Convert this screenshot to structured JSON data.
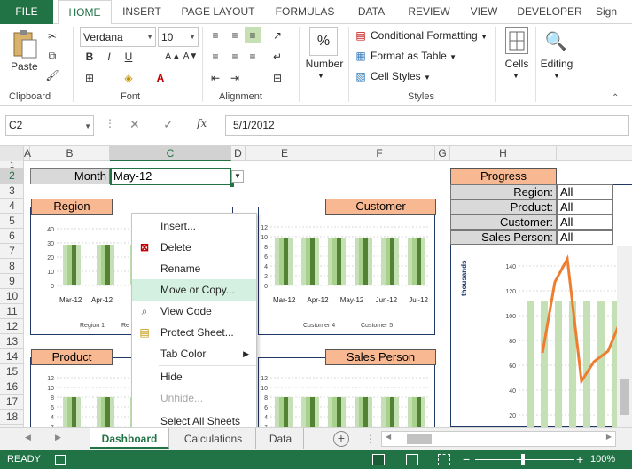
{
  "ribbon": {
    "tabs": [
      "FILE",
      "HOME",
      "INSERT",
      "PAGE LAYOUT",
      "FORMULAS",
      "DATA",
      "REVIEW",
      "VIEW",
      "DEVELOPER",
      "Sign"
    ],
    "font_name": "Verdana",
    "font_size": "10",
    "paste_label": "Paste",
    "groups": {
      "clipboard": "Clipboard",
      "font": "Font",
      "alignment": "Alignment",
      "number": "Number",
      "styles": "Styles",
      "cells": "Cells",
      "editing": "Editing"
    },
    "number_label": "Number",
    "percent_symbol": "%",
    "conditional_formatting": "Conditional Formatting",
    "format_as_table": "Format as Table",
    "cell_styles": "Cell Styles",
    "cells_label": "Cells",
    "editing_label": "Editing",
    "bold": "B",
    "italic": "I",
    "underline": "U"
  },
  "formula_bar": {
    "name_box": "C2",
    "value": "5/1/2012",
    "fx": "fx"
  },
  "columns": [
    "A",
    "B",
    "C",
    "D",
    "E",
    "F",
    "G",
    "H"
  ],
  "rows": [
    "1",
    "2",
    "3",
    "4",
    "5",
    "6",
    "7",
    "8",
    "9",
    "10",
    "11",
    "12",
    "13",
    "14",
    "15",
    "16",
    "17",
    "18"
  ],
  "sheet": {
    "month_label": "Month",
    "month_value": "May-12",
    "region_title": "Region",
    "customer_title": "Customer",
    "product_title": "Product",
    "sales_person_title": "Sales Person",
    "progress_title": "Progress",
    "filters": [
      {
        "label": "Region:",
        "value": "All"
      },
      {
        "label": "Product:",
        "value": "All"
      },
      {
        "label": "Customer:",
        "value": "All"
      },
      {
        "label": "Sales Person:",
        "value": "All"
      }
    ],
    "region_chart": {
      "y_ticks": [
        "40",
        "30",
        "20",
        "10",
        "0"
      ],
      "x_labels": [
        "Mar-12",
        "Apr-12"
      ],
      "legend": [
        "Region 1",
        "Re"
      ]
    },
    "customer_chart": {
      "y_ticks": [
        "12",
        "10",
        "8",
        "6",
        "4",
        "2",
        "0"
      ],
      "x_labels": [
        "Mar-12",
        "Apr-12",
        "May-12",
        "Jun-12",
        "Jul-12"
      ],
      "legend": [
        "Customer 4",
        "Customer 5"
      ]
    },
    "product_chart": {
      "y_ticks": [
        "12",
        "10",
        "8",
        "6",
        "4",
        "2"
      ]
    },
    "sales_chart": {
      "y_ticks": [
        "12",
        "10",
        "8",
        "6",
        "4",
        "2"
      ]
    },
    "progress_chart": {
      "ylabel": "thousands",
      "y_ticks": [
        "140",
        "120",
        "100",
        "80",
        "60",
        "40",
        "20"
      ]
    }
  },
  "context_menu": {
    "items": [
      {
        "label": "Insert...",
        "icon": "",
        "disabled": false
      },
      {
        "label": "Delete",
        "icon": "delete-sheet-icon",
        "disabled": false
      },
      {
        "label": "Rename",
        "icon": "",
        "disabled": false
      },
      {
        "label": "Move or Copy...",
        "icon": "",
        "disabled": false,
        "highlight": true
      },
      {
        "label": "View Code",
        "icon": "view-code-icon",
        "disabled": false
      },
      {
        "label": "Protect Sheet...",
        "icon": "protect-sheet-icon",
        "disabled": false
      },
      {
        "label": "Tab Color",
        "icon": "",
        "disabled": false,
        "submenu": true
      },
      {
        "label": "Hide",
        "icon": "",
        "disabled": false
      },
      {
        "label": "Unhide...",
        "icon": "",
        "disabled": true
      },
      {
        "label": "Select All Sheets",
        "icon": "",
        "disabled": false
      }
    ]
  },
  "sheet_tabs": [
    "Dashboard",
    "Calculations",
    "Data"
  ],
  "status": {
    "ready": "READY",
    "zoom": "100%"
  },
  "colors": {
    "excel_green": "#217346",
    "orange": "#f8b992",
    "bar_dark": "#548235",
    "bar_light": "#c5e0b4",
    "line_orange": "#ed7d31"
  }
}
